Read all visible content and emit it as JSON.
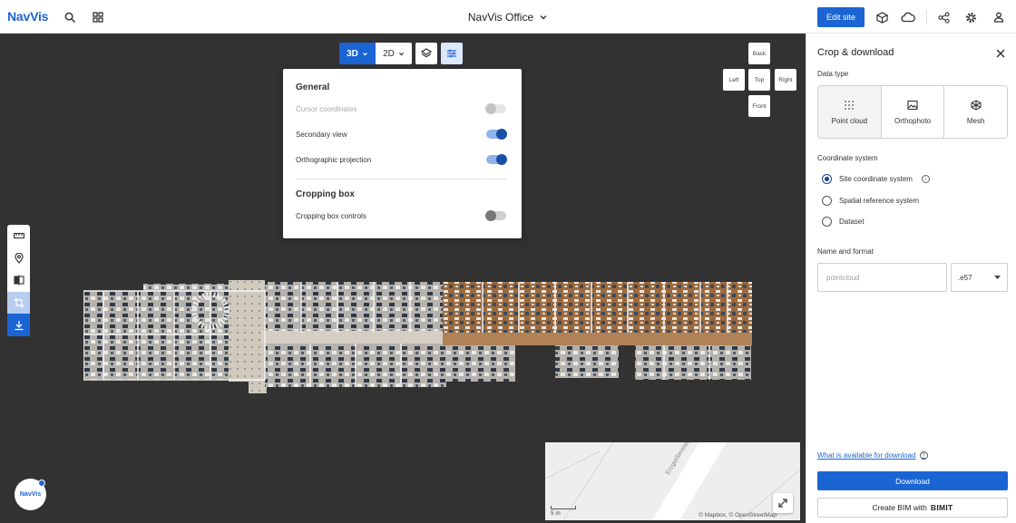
{
  "header": {
    "logo": "NavVis",
    "title": "NavVis Office",
    "edit_label": "Edit site",
    "icons": [
      "search-icon",
      "apps-grid-icon",
      "chevron-down-icon",
      "cube-icon",
      "cloud-icon",
      "share-icon",
      "gear-icon",
      "user-icon"
    ]
  },
  "viewer": {
    "modes": {
      "mode_3d": "3D",
      "mode_2d": "2D",
      "active": "3D"
    },
    "settings": {
      "general_heading": "General",
      "cursor_coordinates": {
        "label": "Cursor coordinates",
        "enabled": false,
        "disabled": true
      },
      "secondary_view": {
        "label": "Secondary view",
        "enabled": true
      },
      "orthographic_projection": {
        "label": "Orthographic projection",
        "enabled": true
      },
      "cropping_heading": "Cropping box",
      "cropping_box_controls": {
        "label": "Cropping box controls",
        "enabled": false
      }
    },
    "view_cube": {
      "back": "Back",
      "left": "Left",
      "top": "Top",
      "right": "Right",
      "front": "Front"
    },
    "left_tools": [
      "ruler-icon",
      "location-pin-icon",
      "compare-icon",
      "crop-icon",
      "download-icon"
    ],
    "minimap": {
      "scale_label": "5 m",
      "attribution": "© Mapbox, © OpenStreetMap",
      "street_label": "Erzgießereistr."
    },
    "badge": "NavVis"
  },
  "panel": {
    "title": "Crop & download",
    "data_type_label": "Data type",
    "data_types": [
      {
        "label": "Point cloud",
        "icon": "point-cloud-icon",
        "selected": true
      },
      {
        "label": "Orthophoto",
        "icon": "image-icon",
        "selected": false
      },
      {
        "label": "Mesh",
        "icon": "mesh-icon",
        "selected": false
      }
    ],
    "coordinate_system_label": "Coordinate system",
    "coordinate_options": [
      {
        "label": "Site coordinate system",
        "selected": true
      },
      {
        "label": "Spatial reference system",
        "selected": false
      },
      {
        "label": "Dataset",
        "selected": false
      }
    ],
    "name_format_label": "Name and format",
    "name_placeholder": "pointcloud",
    "format_value": ".e57",
    "help_link": "What is available for download",
    "download_label": "Download",
    "bim_label": "Create BIM with",
    "bim_brand": "BIMIT"
  },
  "colors": {
    "accent": "#1b64d4",
    "viewport_bg": "#323232"
  }
}
